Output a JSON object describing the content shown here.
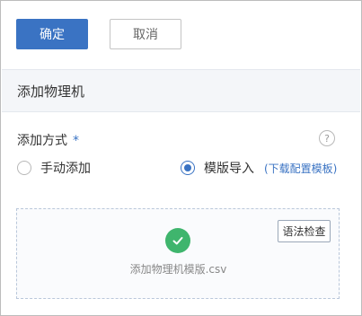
{
  "actions": {
    "confirm_label": "确定",
    "cancel_label": "取消"
  },
  "section": {
    "title": "添加物理机"
  },
  "form": {
    "field_label": "添加方式",
    "required_marker": "*",
    "help_glyph": "?",
    "options": [
      {
        "label": "手动添加",
        "checked": false
      },
      {
        "label": "模版导入",
        "checked": true
      }
    ],
    "template_link": "(下载配置模板)"
  },
  "upload": {
    "syntax_check_label": "语法检查",
    "file_name": "添加物理机模版.csv",
    "status_icon": "check-circle-icon"
  },
  "colors": {
    "primary": "#3a73c3",
    "success": "#3fb56d"
  }
}
